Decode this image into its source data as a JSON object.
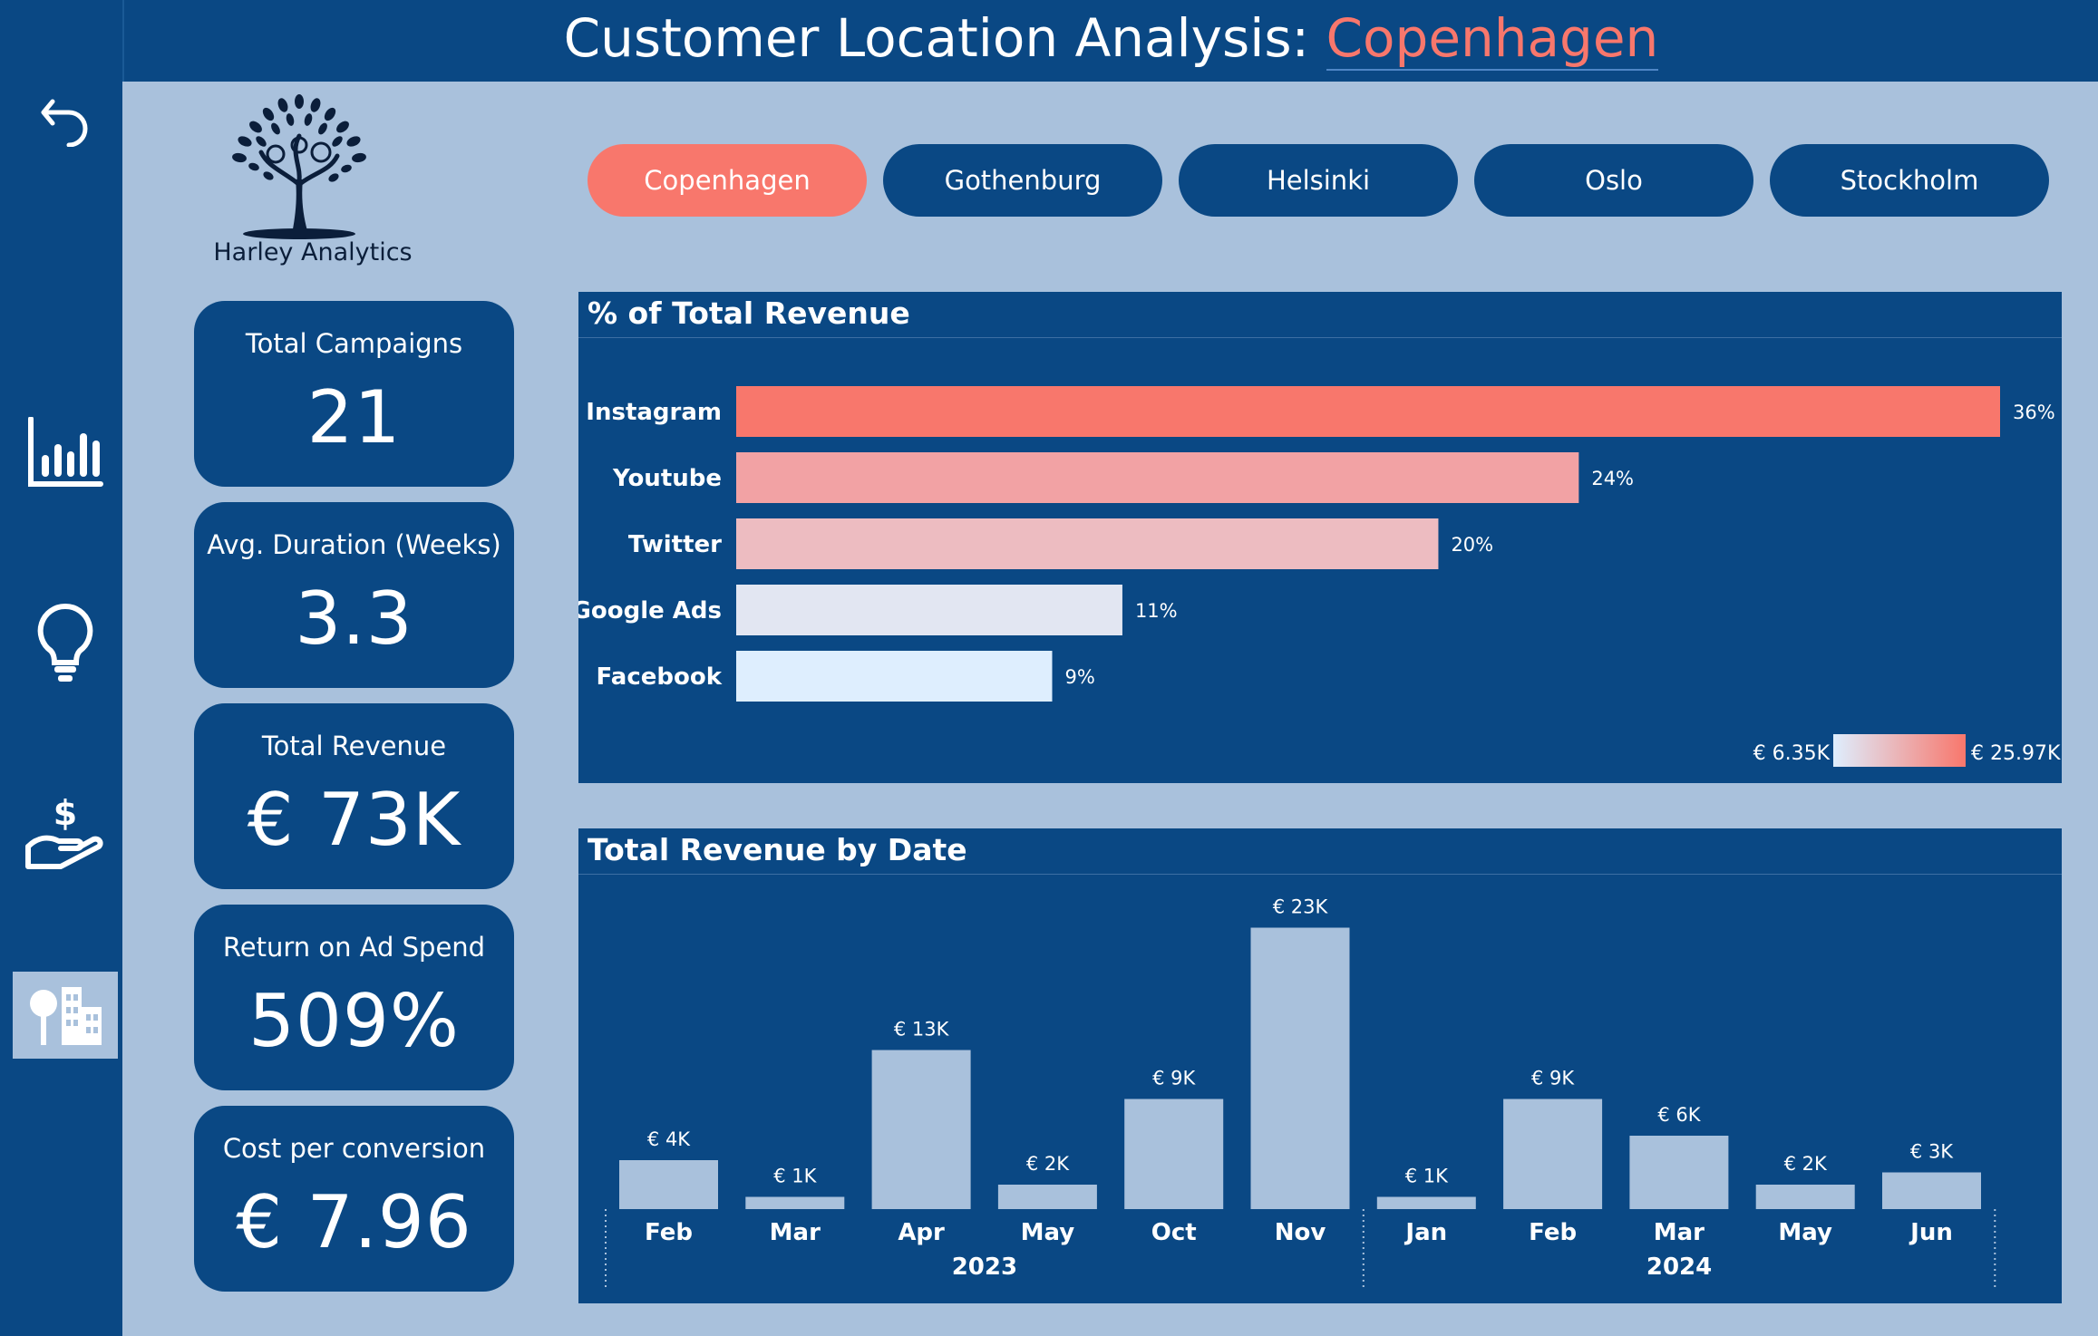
{
  "header": {
    "title_prefix": "Customer Location Analysis: ",
    "title_city": "Copenhagen"
  },
  "logo": {
    "name": "Harley Analytics"
  },
  "nav": [
    {
      "icon": "back-arrow-icon"
    },
    {
      "icon": "bar-chart-icon"
    },
    {
      "icon": "lightbulb-icon"
    },
    {
      "icon": "hand-dollar-icon"
    },
    {
      "icon": "city-buildings-icon",
      "active": true
    }
  ],
  "cities": [
    {
      "label": "Copenhagen",
      "selected": true
    },
    {
      "label": "Gothenburg",
      "selected": false
    },
    {
      "label": "Helsinki",
      "selected": false
    },
    {
      "label": "Oslo",
      "selected": false
    },
    {
      "label": "Stockholm",
      "selected": false
    }
  ],
  "kpis": [
    {
      "label": "Total Campaigns",
      "value": "21"
    },
    {
      "label": "Avg. Duration (Weeks)",
      "value": "3.3"
    },
    {
      "label": "Total Revenue",
      "value": "€ 73K"
    },
    {
      "label": "Return on Ad Spend",
      "value": "509%"
    },
    {
      "label": "Cost per conversion",
      "value": "€ 7.96"
    }
  ],
  "colors": {
    "navy": "#0a4884",
    "background": "#a9c1dc",
    "accent": "#f8776c",
    "column": "#a9c1dc"
  },
  "chart_data": [
    {
      "type": "bar",
      "orientation": "horizontal",
      "title": "% of Total Revenue",
      "categories": [
        "Instagram",
        "Youtube",
        "Twitter",
        "Google Ads",
        "Facebook"
      ],
      "values": [
        36,
        24,
        20,
        11,
        9
      ],
      "data_labels": [
        "36%",
        "24%",
        "20%",
        "11%",
        "9%"
      ],
      "bar_colors": [
        "#f8776c",
        "#f2a2a4",
        "#edbcc1",
        "#e2e6f2",
        "#deeefe"
      ],
      "color_scale": {
        "min_label": "€ 6.35K",
        "max_label": "€ 25.97K",
        "min_color": "#deeefe",
        "max_color": "#f8776c"
      }
    },
    {
      "type": "bar",
      "title": "Total Revenue by Date",
      "categories": [
        "Feb",
        "Mar",
        "Apr",
        "May",
        "Oct",
        "Nov",
        "Jan",
        "Feb",
        "Mar",
        "May",
        "Jun"
      ],
      "groups": [
        {
          "label": "2023",
          "count": 6
        },
        {
          "label": "2024",
          "count": 5
        }
      ],
      "values": [
        4,
        1,
        13,
        2,
        9,
        23,
        1,
        9,
        6,
        2,
        3
      ],
      "data_labels": [
        "€ 4K",
        "€ 1K",
        "€ 13K",
        "€ 2K",
        "€ 9K",
        "€ 23K",
        "€ 1K",
        "€ 9K",
        "€ 6K",
        "€ 2K",
        "€ 3K"
      ],
      "unit": "€ K"
    }
  ]
}
